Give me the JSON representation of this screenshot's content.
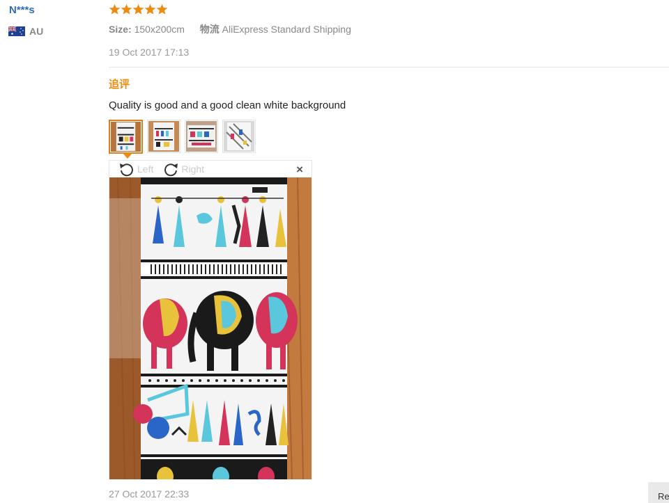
{
  "review": {
    "user_name": "N***s",
    "country_code": "AU",
    "rating": 5,
    "size_label": "Size:",
    "size_value": "150x200cm",
    "shipping_label": "物流",
    "shipping_value": "AliExpress Standard Shipping",
    "date": "19 Oct 2017 17:13"
  },
  "followup": {
    "label": "追评",
    "text": "Quality is good and a good clean white background",
    "thumbnail_count": 4,
    "active_thumbnail": 1,
    "date": "27 Oct 2017 22:33"
  },
  "viewer": {
    "rotate_left_label": "Left",
    "rotate_right_label": "Right",
    "close_icon": "×"
  },
  "corner_button_label": "Re",
  "colors": {
    "username": "#2f6bbf",
    "star": "#f0890f",
    "followup_label": "#f0890f",
    "active_border": "#e07d1d"
  }
}
